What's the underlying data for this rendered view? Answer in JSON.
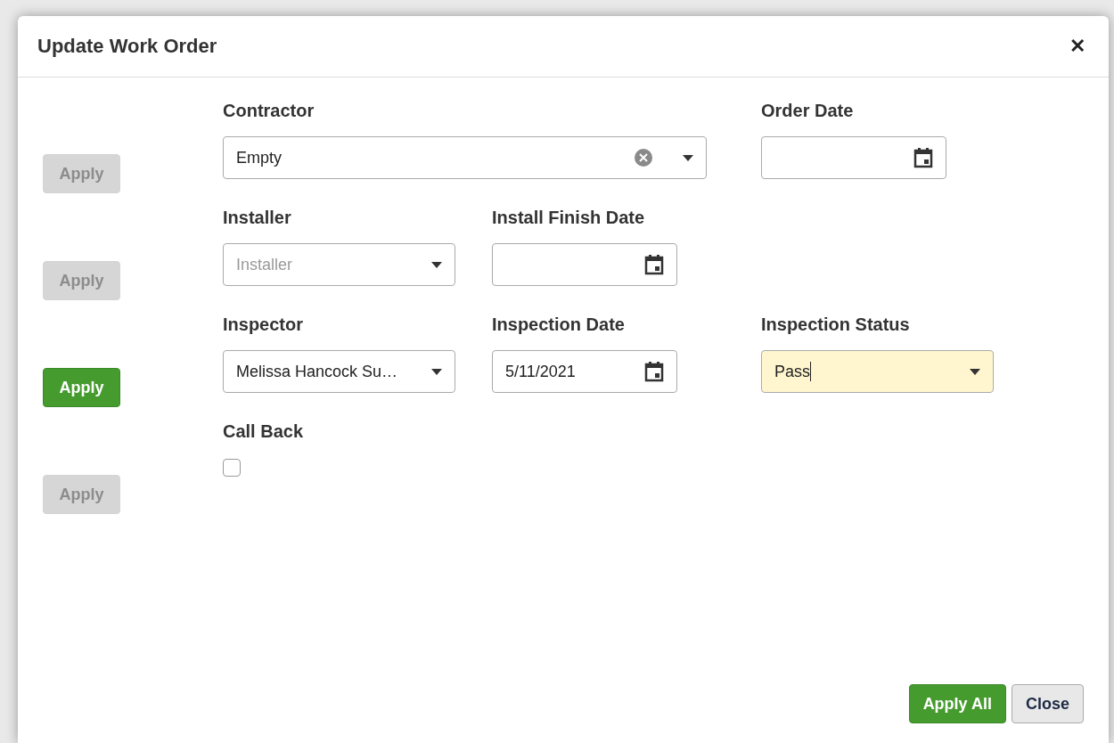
{
  "dialog": {
    "title": "Update Work Order",
    "close_symbol": "✕"
  },
  "rows": [
    {
      "apply": {
        "label": "Apply",
        "enabled": false
      },
      "fields": [
        {
          "kind": "combo",
          "label": "Contractor",
          "value": "Empty"
        },
        {
          "kind": "date",
          "label": "Order Date"
        }
      ]
    },
    {
      "apply": {
        "label": "Apply",
        "enabled": false
      },
      "fields": [
        {
          "kind": "select",
          "label": "Installer",
          "placeholder": "Installer"
        },
        {
          "kind": "date",
          "label": "Install Finish Date"
        }
      ]
    },
    {
      "apply": {
        "label": "Apply",
        "enabled": true
      },
      "fields": [
        {
          "kind": "select",
          "label": "Inspector",
          "value": "Melissa Hancock Su…"
        },
        {
          "kind": "date",
          "label": "Inspection Date",
          "value": "5/11/2021"
        },
        {
          "kind": "select",
          "label": "Inspection Status",
          "value": "Pass",
          "focused": true
        }
      ]
    },
    {
      "apply": {
        "label": "Apply",
        "enabled": false
      },
      "fields": [
        {
          "kind": "checkbox",
          "label": "Call Back",
          "checked": false
        }
      ]
    }
  ],
  "footer": {
    "buttons": [
      {
        "label": "Apply All",
        "kind": "primary"
      },
      {
        "label": "Close",
        "kind": "secondary"
      }
    ]
  }
}
